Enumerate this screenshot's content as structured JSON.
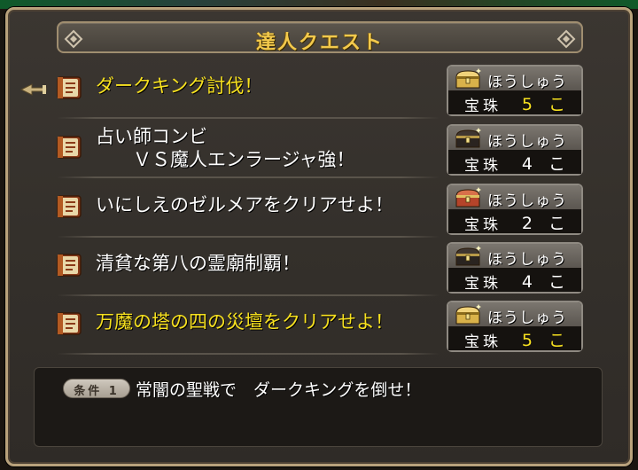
{
  "window": {
    "title": "達人クエスト"
  },
  "quests": [
    {
      "name": "ダークキング討伐！",
      "highlight": true,
      "selected": true,
      "reward": {
        "label": "ほうしゅう",
        "item": "宝珠",
        "count": "5 こ",
        "chest": "gold"
      }
    },
    {
      "name": "占い師コンビ\n　　ＶＳ魔人エンラージャ強！",
      "highlight": false,
      "selected": false,
      "reward": {
        "label": "ほうしゅう",
        "item": "宝珠",
        "count": "4 こ",
        "chest": "black"
      }
    },
    {
      "name": "いにしえのゼルメアをクリアせよ！",
      "highlight": false,
      "selected": false,
      "reward": {
        "label": "ほうしゅう",
        "item": "宝珠",
        "count": "2 こ",
        "chest": "red"
      }
    },
    {
      "name": "清貧な第八の霊廟制覇！",
      "highlight": false,
      "selected": false,
      "reward": {
        "label": "ほうしゅう",
        "item": "宝珠",
        "count": "4 こ",
        "chest": "black"
      }
    },
    {
      "name": "万魔の塔の四の災壇をクリアせよ！",
      "highlight": true,
      "selected": false,
      "reward": {
        "label": "ほうしゅう",
        "item": "宝珠",
        "count": "5 こ",
        "chest": "gold"
      }
    }
  ],
  "condition": {
    "tag": "条件 1",
    "text": "常闇の聖戦で　ダークキングを倒せ！"
  },
  "colors": {
    "gold_text": "#f7e11f",
    "title_text": "#f2c94c",
    "frame": "#b9a27c"
  }
}
